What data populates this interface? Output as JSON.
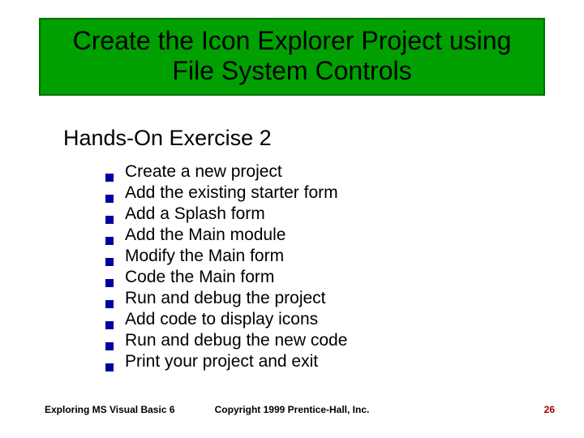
{
  "title": "Create the Icon Explorer Project using File System Controls",
  "subtitle": "Hands-On Exercise 2",
  "bullets": [
    "Create a new project",
    "Add the existing starter form",
    "Add a Splash form",
    "Add the Main module",
    "Modify the Main form",
    "Code the Main form",
    "Run and debug the project",
    "Add code to display icons",
    "Run and debug the new code",
    "Print your project and exit"
  ],
  "footer": {
    "left": "Exploring MS Visual Basic 6",
    "center": "Copyright 1999 Prentice-Hall, Inc.",
    "right": "26"
  }
}
